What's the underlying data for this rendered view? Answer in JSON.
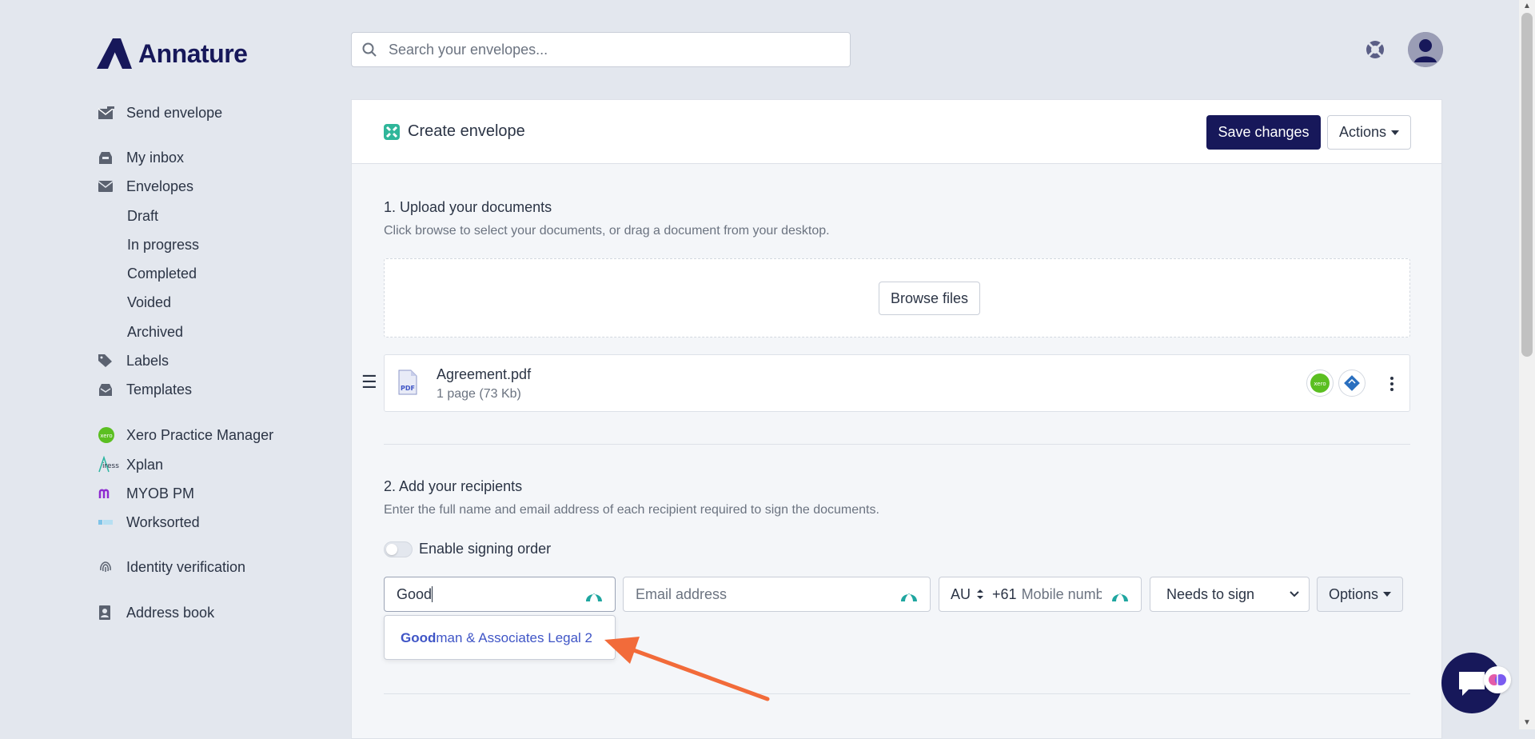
{
  "brand": {
    "name": "Annature",
    "color": "#17185a"
  },
  "search": {
    "placeholder": "Search your envelopes..."
  },
  "sidebar": {
    "send": "Send envelope",
    "inbox": "My inbox",
    "envelopes": "Envelopes",
    "sub": [
      "Draft",
      "In progress",
      "Completed",
      "Voided",
      "Archived"
    ],
    "labels": "Labels",
    "templates": "Templates",
    "integrations": [
      "Xero Practice Manager",
      "Xplan",
      "MYOB PM",
      "Worksorted"
    ],
    "identity": "Identity verification",
    "address_book": "Address book"
  },
  "header": {
    "title": "Create envelope",
    "save": "Save changes",
    "actions": "Actions"
  },
  "upload": {
    "title": "1. Upload your documents",
    "desc": "Click browse to select your documents, or drag a document from your desktop.",
    "browse": "Browse files",
    "document": {
      "name": "Agreement.pdf",
      "meta": "1 page (73 Kb)"
    }
  },
  "recipients": {
    "title": "2. Add your recipients",
    "desc": "Enter the full name and email address of each recipient required to sign the documents.",
    "signing_order": "Enable signing order",
    "name_value": "Good",
    "email_placeholder": "Email address",
    "country": "AU",
    "dial_code": "+61",
    "mobile_placeholder": "Mobile number",
    "role": "Needs to sign",
    "options": "Options",
    "suggestion_match": "Good",
    "suggestion_rest": "man & Associates Legal 2"
  },
  "colors": {
    "accent": "#17185a",
    "link": "#3f55c6",
    "annotation_arrow": "#f26b3a",
    "xero": "#5bbf21"
  }
}
